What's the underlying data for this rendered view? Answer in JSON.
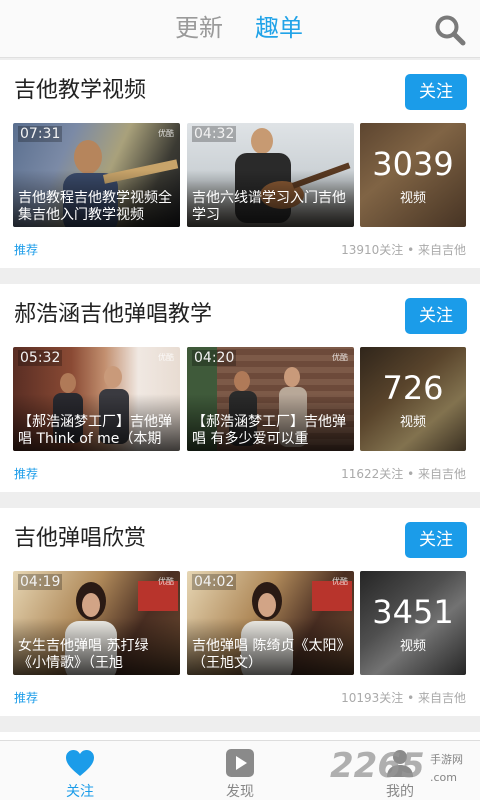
{
  "header": {
    "tabs": [
      {
        "label": "更新",
        "active": false
      },
      {
        "label": "趣单",
        "active": true
      }
    ],
    "search_icon": "search-icon"
  },
  "cards": [
    {
      "title": "吉他教学视频",
      "follow_label": "关注",
      "videos": [
        {
          "duration": "07:31",
          "watermark": "优酷",
          "title": "吉他教程吉他教学视频全集吉他入门教学视频"
        },
        {
          "duration": "04:32",
          "watermark": "",
          "title": "吉他六线谱学习入门吉他学习"
        }
      ],
      "video_count": "3039",
      "video_count_label": "视频",
      "tag": "推荐",
      "meta": "13910关注 • 来自吉他"
    },
    {
      "title": "郝浩涵吉他弹唱教学",
      "follow_label": "关注",
      "videos": [
        {
          "duration": "05:32",
          "watermark": "优酷",
          "title": "【郝浩涵梦工厂】吉他弹唱 Think of me（本期"
        },
        {
          "duration": "04:20",
          "watermark": "优酷",
          "title": "【郝浩涵梦工厂】吉他弹唱 有多少爱可以重"
        }
      ],
      "video_count": "726",
      "video_count_label": "视频",
      "tag": "推荐",
      "meta": "11622关注 • 来自吉他"
    },
    {
      "title": "吉他弹唱欣赏",
      "follow_label": "关注",
      "videos": [
        {
          "duration": "04:19",
          "watermark": "优酷",
          "title": "女生吉他弹唱 苏打绿《小情歌》（王旭"
        },
        {
          "duration": "04:02",
          "watermark": "优酷",
          "title": "吉他弹唱 陈绮贞《太阳》（王旭文）"
        }
      ],
      "video_count": "3451",
      "video_count_label": "视频",
      "tag": "推荐",
      "meta": "10193关注 • 来自吉他"
    }
  ],
  "bottom_nav": [
    {
      "label": "关注",
      "icon": "heart-icon",
      "active": true
    },
    {
      "label": "发现",
      "icon": "play-icon",
      "active": false
    },
    {
      "label": "我的",
      "icon": "person-icon",
      "active": false
    }
  ],
  "watermark": {
    "text": "2265",
    "subtitle": "手游网",
    "url": ".com"
  },
  "colors": {
    "accent": "#1b9ce9",
    "tab_active": "#21a3e8",
    "tab_inactive": "#9a9a9a"
  }
}
